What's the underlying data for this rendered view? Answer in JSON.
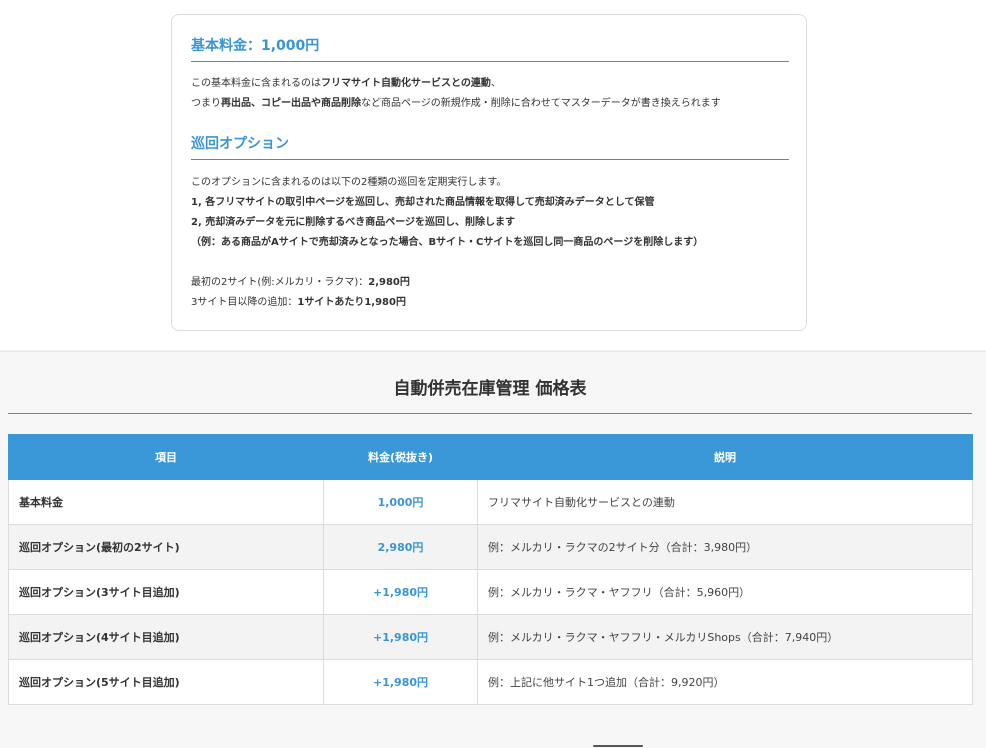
{
  "plan_card": {
    "base_title": "基本料金：1,000円",
    "base_line1_pre": "この基本料金に含まれるのは",
    "base_line1_bold": "フリマサイト自動化サービスとの連動",
    "base_line1_post": "、",
    "base_line2_pre": "つまり",
    "base_line2_bold": "再出品、コピー出品や商品削除",
    "base_line2_post": "など商品ページの新規作成・削除に合わせてマスターデータが書き換えられます",
    "patrol_title": "巡回オプション",
    "patrol_intro": "このオプションに含まれるのは以下の2種類の巡回を定期実行します。",
    "patrol_item1": "1, 各フリマサイトの取引中ページを巡回し、売却された商品情報を取得して売却済みデータとして保管",
    "patrol_item2": "2, 売却済みデータを元に削除するべき商品ページを巡回し、削除します",
    "patrol_example": "（例：ある商品がAサイトで売却済みとなった場合、Bサイト・Cサイトを巡回し同一商品のページを削除します）",
    "price_first_label": "最初の2サイト(例:メルカリ・ラクマ)：",
    "price_first_value": "2,980円",
    "price_add_label": "3サイト目以降の追加：",
    "price_add_value": "1サイトあたり1,980円"
  },
  "price_table": {
    "title": "自動併売在庫管理 価格表",
    "headers": [
      "項目",
      "料金(税抜き)",
      "説明"
    ],
    "rows": [
      {
        "item": "基本料金",
        "fee": "1,000円",
        "desc": "フリマサイト自動化サービスとの連動"
      },
      {
        "item": "巡回オプション(最初の2サイト)",
        "fee": "2,980円",
        "desc": "例：メルカリ・ラクマの2サイト分（合計：3,980円）"
      },
      {
        "item": "巡回オプション(3サイト目追加)",
        "fee": "+1,980円",
        "desc": "例：メルカリ・ラクマ・ヤフフリ（合計：5,960円）"
      },
      {
        "item": "巡回オプション(4サイト目追加)",
        "fee": "+1,980円",
        "desc": "例：メルカリ・ラクマ・ヤフフリ・メルカリShops（合計：7,940円）"
      },
      {
        "item": "巡回オプション(5サイト目追加)",
        "fee": "+1,980円",
        "desc": "例：上記に他サイト1つ追加（合計：9,920円）"
      }
    ]
  },
  "colors": {
    "accent": "#3a95d6",
    "header_bg": "#3a98d8",
    "border": "#dcdcdc"
  }
}
